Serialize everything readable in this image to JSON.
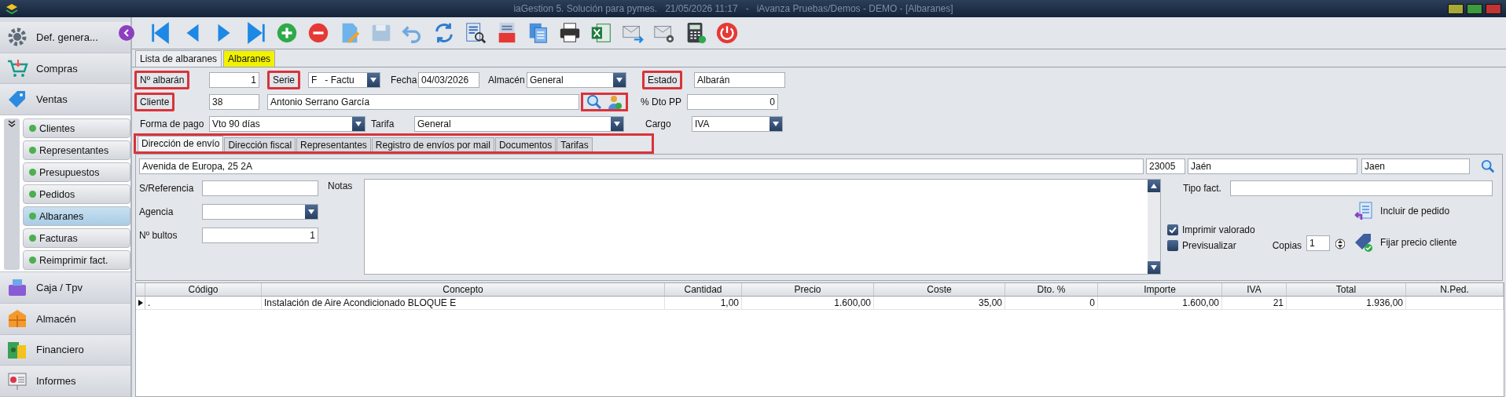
{
  "window": {
    "title": "iaGestion 5. Solución para pymes.   21/05/2026 11:17   -   iAvanza Pruebas/Demos - DEMO - [Albaranes]"
  },
  "sidebar": {
    "items": [
      {
        "label": "Def. genera..."
      },
      {
        "label": "Compras"
      },
      {
        "label": "Ventas",
        "children": [
          {
            "label": "Clientes",
            "selected": false
          },
          {
            "label": "Representantes",
            "selected": false
          },
          {
            "label": "Presupuestos",
            "selected": false
          },
          {
            "label": "Pedidos",
            "selected": false
          },
          {
            "label": "Albaranes",
            "selected": true
          },
          {
            "label": "Facturas",
            "selected": false
          },
          {
            "label": "Reimprimir fact.",
            "selected": false
          }
        ]
      },
      {
        "label": "Caja / Tpv"
      },
      {
        "label": "Almacén"
      },
      {
        "label": "Financiero"
      },
      {
        "label": "Informes"
      }
    ]
  },
  "tabs": [
    {
      "label": "Lista de albaranes",
      "selected": false
    },
    {
      "label": "Albaranes",
      "selected": true
    }
  ],
  "header": {
    "numero": {
      "label": "Nº albarán",
      "value": "1",
      "highlighted": true
    },
    "serie": {
      "label": "Serie",
      "value": "F   - Factu",
      "highlighted": true
    },
    "fecha": {
      "label": "Fecha",
      "value": "04/03/2026",
      "highlighted": false
    },
    "almacen": {
      "label": "Almacén",
      "value": "General",
      "highlighted": false
    },
    "estado": {
      "label": "Estado",
      "value": "Albarán",
      "highlighted": true
    },
    "cliente": {
      "label": "Cliente",
      "value": "38",
      "name": "Antonio Serrano García",
      "highlighted": true,
      "buttons_highlighted": true
    },
    "dto_pp": {
      "label": "% Dto PP",
      "value": "0",
      "highlighted": false
    },
    "forma_pago": {
      "label": "Forma de pago",
      "value": "Vto 90 días",
      "highlighted": false
    },
    "tarifa": {
      "label": "Tarifa",
      "value": "General",
      "highlighted": false
    },
    "cargo": {
      "label": "Cargo",
      "value": "IVA",
      "highlighted": false
    }
  },
  "subtabs": {
    "highlighted": true,
    "items": [
      {
        "label": "Dirección de envío",
        "selected": true
      },
      {
        "label": "Dirección fiscal",
        "selected": false
      },
      {
        "label": "Representantes",
        "selected": false
      },
      {
        "label": "Registro de envíos por mail",
        "selected": false
      },
      {
        "label": "Documentos",
        "selected": false
      },
      {
        "label": "Tarifas",
        "selected": false
      }
    ]
  },
  "shipping": {
    "address": "Avenida de Europa, 25 2A",
    "postal_code": "23005",
    "city": "Jaén",
    "province": "Jaen",
    "s_referencia": {
      "label": "S/Referencia"
    },
    "agencia": {
      "label": "Agencia"
    },
    "bultos": {
      "label": "Nº bultos",
      "value": "1"
    },
    "notas": {
      "label": "Notas"
    },
    "tipo_fact": {
      "label": "Tipo fact."
    },
    "imprimir_valorado": {
      "label": "Imprimir valorado",
      "checked": true
    },
    "previsualizar": {
      "label": "Previsualizar",
      "checked": false
    },
    "copias": {
      "label": "Copias",
      "value": "1"
    },
    "actions": [
      "Incluir de pedido",
      "Fijar precio cliente"
    ]
  },
  "table": {
    "columns": [
      "Código",
      "Concepto",
      "Cantidad",
      "Precio",
      "Coste",
      "Dto. %",
      "Importe",
      "IVA",
      "Total",
      "N.Ped."
    ],
    "rows": [
      {
        "current": true,
        "cells": [
          ".",
          "Instalación de Aire Acondicionado BLOQUE E",
          "1,00",
          "1.600,00",
          "35,00",
          "0",
          "1.600,00",
          "21",
          "1.936,00",
          ""
        ]
      }
    ]
  }
}
